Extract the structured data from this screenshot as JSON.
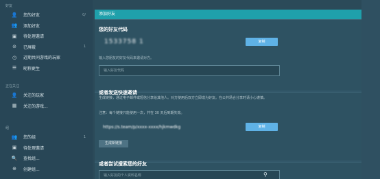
{
  "sidebar": {
    "section1": {
      "heading": "好友",
      "items": [
        {
          "icon": "user-icon",
          "glyph": "👤",
          "label": "您的好友",
          "badge": "0/"
        },
        {
          "icon": "add-user-icon",
          "glyph": "👥",
          "label": "添加好友"
        },
        {
          "icon": "pending-icon",
          "glyph": "▣",
          "label": "待处理邀请"
        },
        {
          "icon": "blocked-icon",
          "glyph": "⊘",
          "label": "已屏蔽",
          "badge": "1"
        },
        {
          "icon": "recent-icon",
          "glyph": "◷",
          "label": "近期共同游戏的玩家"
        },
        {
          "icon": "nickname-icon",
          "glyph": "☰",
          "label": "昵称更生"
        }
      ]
    },
    "section2": {
      "heading": "正在关注",
      "items": [
        {
          "icon": "followed-players-icon",
          "glyph": "👤",
          "label": "关注的玩家"
        },
        {
          "icon": "followed-games-icon",
          "glyph": "▦",
          "label": "关注的游戏..."
        }
      ]
    },
    "section3": {
      "heading": "组",
      "items": [
        {
          "icon": "group-icon",
          "glyph": "👥",
          "label": "您的组",
          "badge": "1"
        },
        {
          "icon": "pending-group-icon",
          "glyph": "▣",
          "label": "待处理邀请"
        },
        {
          "icon": "find-group-icon",
          "glyph": "🔍",
          "label": "查找组..."
        },
        {
          "icon": "create-group-icon",
          "glyph": "⊕",
          "label": "创建组..."
        }
      ]
    }
  },
  "panel": {
    "header": "添加好友",
    "friend_code": {
      "title": "您的好友代码",
      "value": "1533758 1",
      "copy_label": "复制",
      "hint": "输入您朋友的好友代码来邀请对方。",
      "input_placeholder": "输入好友代码"
    },
    "quick_invite": {
      "title": "或者发送快速邀请",
      "description": "生成链接，通过电子邮件或短信分享给其他人。对方使用后双方立即成为好友。在公共场合分享时请小心谨慎。",
      "note": "注意：每个链接只能使用一次，并在 30 天后到期失效。",
      "link": "https://s.team/p/xxxx-xxxx/hjkmwdkg",
      "copy_label": "复制",
      "generate_label": "生成新链接"
    },
    "search": {
      "title": "或者尝试搜索您的好友",
      "placeholder": "输入好友的个人资料名称"
    }
  }
}
